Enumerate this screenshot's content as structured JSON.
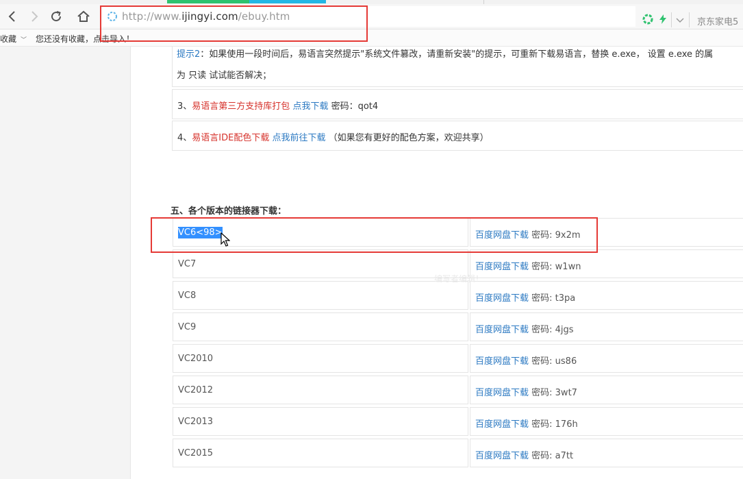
{
  "toolbar": {
    "url_prefix": "http://www.",
    "url_domain": "ijingyi.com",
    "url_path": "/ebuy.htm",
    "right_label": "京东家电5"
  },
  "bookmarks": {
    "favorites_label": "收藏",
    "empty_hint": "您还没有收藏，点击导入！"
  },
  "content": {
    "tip2_label": "提示2",
    "tip2_text": "：如果使用一段时间后，易语言突然提示\"系统文件篡改，请重新安装\"的提示，可重新下载易语言，替换 e.exe， 设置 e.exe 的属",
    "tip2_line2": "为 只读 试试能否解决；",
    "item3": {
      "index": "3、",
      "title": "易语言第三方支持库打包",
      "link": "点我下载",
      "pw": " 密码：qot4"
    },
    "item4": {
      "index": "4、",
      "title": "易语言IDE配色下载",
      "link": "点我前往下载",
      "note": " （如果您有更好的配色方案，欢迎共享）"
    },
    "section_title": "五、各个版本的链接器下载：",
    "watermark": "编写者编辑！"
  },
  "linkers": [
    {
      "version": "VC6<98>",
      "link": "百度网盘下载",
      "pw": " 密码: 9x2m"
    },
    {
      "version": "VC7",
      "link": "百度网盘下载",
      "pw": "  密码: w1wn"
    },
    {
      "version": "VC8",
      "link": "百度网盘下载",
      "pw": " 密码: t3pa"
    },
    {
      "version": "VC9",
      "link": "百度网盘下载",
      "pw": " 密码: 4jgs"
    },
    {
      "version": "VC2010",
      "link": "百度网盘下载",
      "pw": " 密码: us86"
    },
    {
      "version": "VC2012",
      "link": "百度网盘下载",
      "pw": " 密码: 3wt7"
    },
    {
      "version": "VC2013",
      "link": "百度网盘下载",
      "pw": " 密码: 176h"
    },
    {
      "version": "VC2015",
      "link": "百度网盘下载",
      "pw": " 密码: a7tt"
    }
  ],
  "colors": {
    "link": "#2b79c2",
    "highlight_red": "#e53935",
    "text_red": "#d6322b",
    "selection": "#3390ff"
  }
}
